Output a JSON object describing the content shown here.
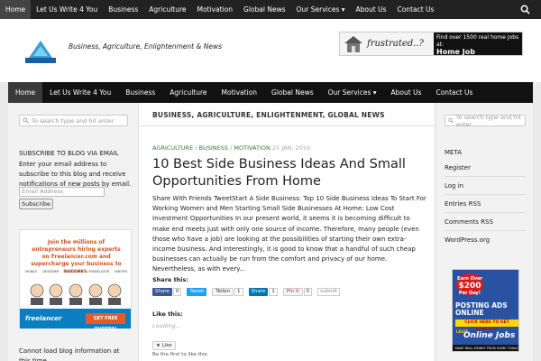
{
  "topbar": {
    "nav": [
      "Home",
      "Let Us Write 4 You",
      "Business",
      "Agriculture",
      "Motivation",
      "Global News",
      "Our Services ▾",
      "About Us",
      "Contact Us"
    ]
  },
  "header": {
    "tagline": "Business, Agriculture, Enlightenment & News",
    "ad": {
      "frustrated": "frustrated..?",
      "line1": "Find over 1500 real home jobs at:",
      "line2": "Home Job Group.com"
    }
  },
  "mainnav": {
    "nav": [
      "Home",
      "Let Us Write 4 You",
      "Business",
      "Agriculture",
      "Motivation",
      "Global News",
      "Our Services ▾",
      "About Us",
      "Contact Us"
    ]
  },
  "search": {
    "placeholder": "To search type and hit enter"
  },
  "main": {
    "breadcrumb": "BUSINESS, AGRICULTURE, ENLIGHTENMENT, GLOBAL NEWS",
    "categories": [
      "AGRICULTURE",
      "BUSINESS",
      "MOTIVATION"
    ],
    "date": "25 JAN, 2016",
    "title": "10 Best Side Business Ideas And Small Opportunities From Home",
    "excerpt": "Share With Friends TweetStart A Side Business: Top 10 Side Business Ideas To Start For Working Women and Men Starting Small Side Businesses At Home: Low Cost Investment Opportunities In our present world, it seems it is becoming difficult to make end meets just with only one source of income. Therefore, many people (even those who have a job) are looking at the possibilities of starting their own extra-income business. And interestingly, it is good to know that a handful of such cheap businesses can actually be run from the comfort and privacy of our home. Nevertheless, as with every...",
    "share_title": "Share this:",
    "share": {
      "fb_label": "Share",
      "fb_count": "0",
      "tweet_label": "Tweet",
      "gplus_label": "Teilen",
      "gplus_count": "1",
      "li_label": "Share",
      "li_count": "1",
      "pin_label": "Pin it",
      "pin_count": "0",
      "su_label": "submit"
    },
    "like_title": "Like this:",
    "loading": "Loading...",
    "like_button": "★ Like",
    "like_first": "Be the first to like this."
  },
  "left": {
    "widget_title": "SUBSCRIBE TO BLOG VIA EMAIL",
    "widget_text": "Enter your email address to subscribe to this blog and receive notifications of new posts by email.",
    "email_placeholder": "Email Address",
    "subscribe": "Subscribe",
    "freelancer": {
      "text": "Join the millions of entrepreneurs hiring experts on Freelancer.com and supercharge your business to success.",
      "roles": [
        "MOBILE",
        "DESIGNER",
        "DEVELOPER",
        "TRANSLATOR",
        "WRITER"
      ],
      "logo": "freelancer",
      "quote": "GET FREE QUOTES!"
    },
    "cannot_load": "Cannot load blog information at this time."
  },
  "right": {
    "meta_title": "META",
    "meta_items": [
      "Register",
      "Log in",
      "Entries RSS",
      "Comments RSS",
      "WordPress.org"
    ],
    "jobs_ad": {
      "earn": "Earn Over",
      "amount": "$200",
      "per_day": "Per Day!",
      "posting": "POSTING ADS ONLINE",
      "click": "CLICK HERE TO GET STARTED!",
      "legit": "LEGIT",
      "online": "Online Jobs",
      "footer": "MAKE REAL MONEY FROM HOME TODAY"
    }
  },
  "colors": {
    "topbar": "#222222",
    "mainnav": "#111111",
    "category_green": "#2e7d32",
    "fb_blue": "#3b5998",
    "tweet_blue": "#1da1f2",
    "linkedin_blue": "#0077b5",
    "freelancer_blue": "#0b7ec0",
    "freelancer_orange": "#e65a2a"
  }
}
